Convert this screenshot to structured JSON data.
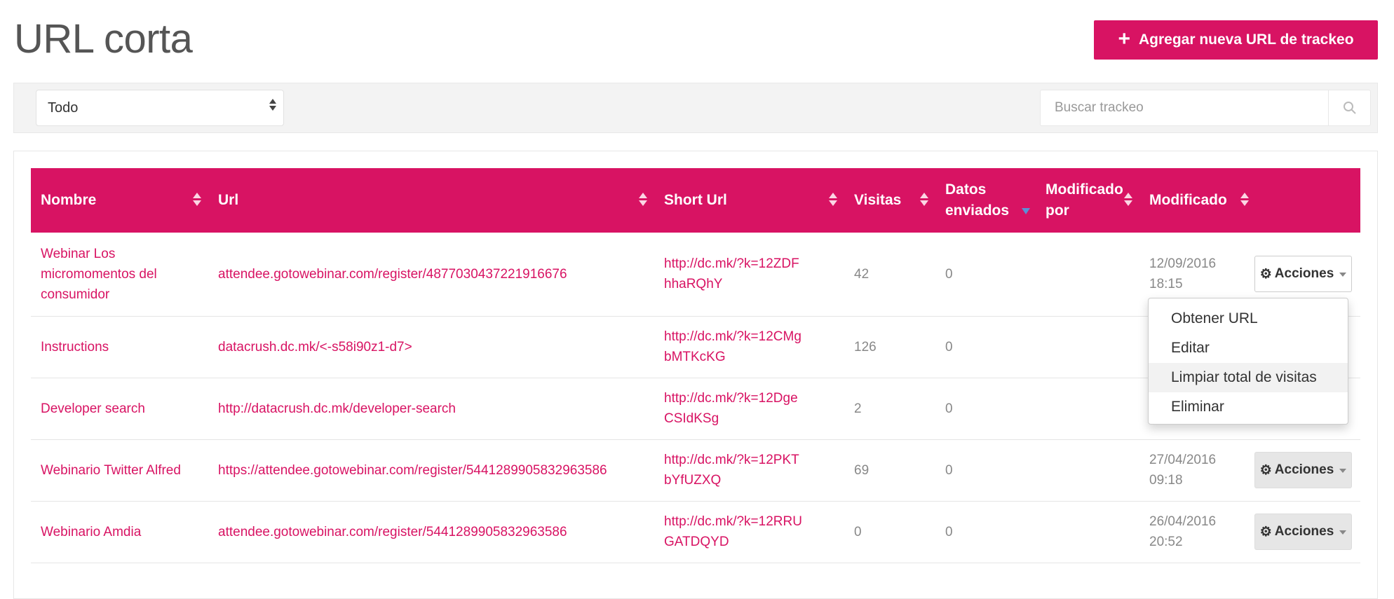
{
  "header": {
    "title": "URL corta",
    "add_button_label": "Agregar nueva URL de trackeo"
  },
  "filter": {
    "select_value": "Todo",
    "search_placeholder": "Buscar trackeo"
  },
  "table": {
    "columns": [
      "Nombre",
      "Url",
      "Short Url",
      "Visitas",
      "Datos enviados",
      "Modificado por",
      "Modificado"
    ],
    "rows": [
      {
        "nombre": "Webinar Los micromomentos del consumidor",
        "url": "attendee.gotowebinar.com/register/4877030437221916676",
        "short_url": "http://dc.mk/?k=12ZDFhhaRQhY",
        "visitas": "42",
        "datos": "0",
        "mod_por": "",
        "modificado": "12/09/2016 18:15",
        "accion": "Acciones"
      },
      {
        "nombre": "Instructions",
        "url": "datacrush.dc.mk/<-s58i90z1-d7>",
        "short_url": "http://dc.mk/?k=12CMgbMTKcKG",
        "visitas": "126",
        "datos": "0",
        "mod_por": "",
        "modificado": "",
        "accion": ""
      },
      {
        "nombre": "Developer search",
        "url": "http://datacrush.dc.mk/developer-search",
        "short_url": "http://dc.mk/?k=12DgeCSIdKSg",
        "visitas": "2",
        "datos": "0",
        "mod_por": "",
        "modificado": "",
        "accion": ""
      },
      {
        "nombre": "Webinario Twitter Alfred",
        "url": "https://attendee.gotowebinar.com/register/5441289905832963586",
        "short_url": "http://dc.mk/?k=12PKTbYfUZXQ",
        "visitas": "69",
        "datos": "0",
        "mod_por": "",
        "modificado": "27/04/2016 09:18",
        "accion": "Acciones"
      },
      {
        "nombre": "Webinario Amdia",
        "url": "attendee.gotowebinar.com/register/5441289905832963586",
        "short_url": "http://dc.mk/?k=12RRUGATDQYD",
        "visitas": "0",
        "datos": "0",
        "mod_por": "",
        "modificado": "26/04/2016 20:52",
        "accion": "Acciones"
      }
    ]
  },
  "actions_menu": {
    "items": [
      "Obtener URL",
      "Editar",
      "Limpiar total de visitas",
      "Eliminar"
    ],
    "hovered_index": 2
  },
  "colors": {
    "brand": "#d81363",
    "sort_active": "#5b8fd6"
  },
  "icons": [
    "plus-icon",
    "search-icon",
    "gear-icon",
    "sort-icon",
    "caret-down-icon"
  ]
}
